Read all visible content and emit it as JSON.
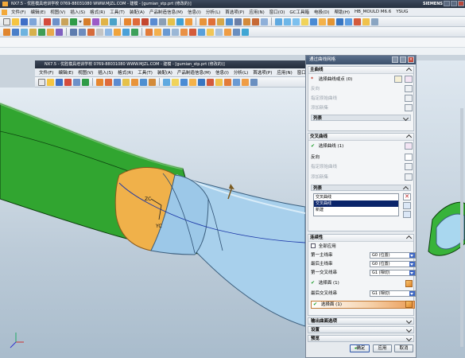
{
  "app": {
    "title": "NX7.5 - 优胜模具培训学校  0769-88031080  WWW.MJZL.COM - 建模 - [gumian_stp.prt (修改的)]",
    "brand": "SIEMENS"
  },
  "menubar": {
    "items": [
      "文件(F)",
      "编辑(E)",
      "视图(V)",
      "插入(S)",
      "格式(R)",
      "工具(T)",
      "装配(A)",
      "产品制造信息(M)",
      "信息(I)",
      "分析(L)",
      "首选项(P)",
      "应用(N)",
      "窗口(O)",
      "GC工具箱",
      "电极(D)",
      "帮助(H)",
      "HB_MOULD M6.6",
      "YSUG"
    ]
  },
  "inner": {
    "title": "NX7.5 - 优胜模具培训学校  0769-88031080  WWW.MJZL.COM - 建模 - [gumian_stp.prt (修改的)]",
    "menubar": [
      "文件(F)",
      "编辑(E)",
      "视图(V)",
      "插入(S)",
      "格式(R)",
      "工具(T)",
      "装配(A)",
      "产品制造信息(M)",
      "信息(I)",
      "分析(L)",
      "首选项(P)",
      "应用(N)",
      "窗口(O)"
    ]
  },
  "viewport": {
    "labels": {
      "zc": "ZC",
      "yc": "YC"
    }
  },
  "dialog": {
    "title": "通过曲线网格",
    "primary": {
      "header": "主曲线",
      "select": "选择曲线或点 (0)",
      "reverse": "反向",
      "specify_origin": "指定原始曲线",
      "add_set": "添加新集",
      "list": "列表"
    },
    "cross": {
      "header": "交叉曲线",
      "select": "选择曲线 (1)",
      "reverse": "反向",
      "specify_origin": "指定原始曲线",
      "add_set": "添加新集",
      "list": "列表",
      "list_items": [
        "交叉曲线",
        "交叉曲线",
        "新建"
      ]
    },
    "continuity": {
      "header": "连续性",
      "apply_all": "全部应用",
      "first_primary_label": "第一主线串",
      "first_primary_value": "G0 (位置)",
      "last_primary_label": "最后主线串",
      "last_primary_value": "G0 (位置)",
      "first_cross_label": "第一交叉线串",
      "first_cross_value": "G1 (相切)",
      "select_face_1": "选择面 (1)",
      "last_cross_label": "最后交叉线串",
      "last_cross_value": "G1 (相切)",
      "select_face_2": "选择面 (1)"
    },
    "collapsed": [
      "输出曲面选项",
      "设置",
      "预览"
    ],
    "buttons": {
      "ok": "确定",
      "apply": "应用",
      "cancel": "取消"
    }
  }
}
